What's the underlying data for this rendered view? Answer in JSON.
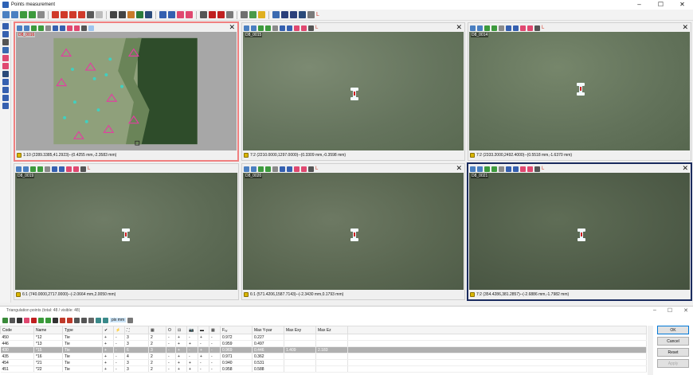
{
  "window": {
    "title": "Points measurement",
    "min": "–",
    "max": "☐",
    "close": "✕"
  },
  "colors": {
    "selected_red": "#f08080",
    "selected_blue": "#1a2b5e",
    "grass": "#5f6f52"
  },
  "panels": [
    {
      "label": "D8_0016",
      "close": "✕",
      "status": "1:10 (2289.3385,41.2923)--(0.4255 mm,-2.3583 mm)"
    },
    {
      "label": "D8_0015",
      "close": "✕",
      "status": "7:2 (2210.0000,1297.0000)--(0.3309 mm,-0.3598 mm)"
    },
    {
      "label": "D8_0014",
      "close": "✕",
      "status": "7:2 (2333.2000,2492.4000)--(0.5518 mm,-1.6370 mm)"
    },
    {
      "label": "D8_0019",
      "close": "✕",
      "status": "6:1 (740.0000,2717.0000)--(-2.0664 mm,2.0050 mm)"
    },
    {
      "label": "D8_0020",
      "close": "✕",
      "status": "6:1 (571.4206,1587.7143)--(-2.3430 mm,0.1793 mm)"
    },
    {
      "label": "D8_0021",
      "close": "✕",
      "status": "7:2 (354.4286,381.2857)--(-2.6886 mm,-1.7982 mm)"
    }
  ],
  "triangulation": {
    "title": "Triangulation points (total: 48 / visible: 48)",
    "window_buttons": [
      "–",
      "☐",
      "✕"
    ],
    "units_label": "pix mm",
    "columns": [
      "Code",
      "Name",
      "Type",
      "✔",
      "⚡",
      "⛶",
      "▦",
      "O",
      "⊟",
      "📷",
      "▬",
      "▦",
      "Fₓᵧ",
      "Max Y-par",
      "Max Exy",
      "Max Ez"
    ],
    "rows": [
      [
        "450",
        "*12",
        "Tie",
        "+",
        "-",
        "3",
        "2",
        "-",
        "+",
        "-",
        "+",
        "-",
        "0.972",
        "0.227",
        "",
        ""
      ],
      [
        "446",
        "*13",
        "Tie",
        "+",
        "-",
        "3",
        "2",
        "-",
        "+",
        "+",
        "-",
        "-",
        "0.959",
        "0.497",
        "",
        ""
      ],
      [
        "430",
        "*15",
        "Tie",
        "+",
        "-",
        "6",
        "3",
        "-",
        "+",
        "-",
        "+",
        "-",
        "0.969",
        "0.446",
        "1.409",
        "2.183"
      ],
      [
        "435",
        "*16",
        "Tie",
        "+",
        "-",
        "4",
        "2",
        "-",
        "+",
        "-",
        "+",
        "-",
        "0.971",
        "0.362",
        "",
        ""
      ],
      [
        "454",
        "*21",
        "Tie",
        "+",
        "-",
        "3",
        "2",
        "-",
        "+",
        "+",
        "-",
        "-",
        "0.940",
        "0.531",
        "",
        ""
      ],
      [
        "451",
        "*22",
        "Tie",
        "+",
        "-",
        "3",
        "2",
        "-",
        "+",
        "+",
        "-",
        "-",
        "0.958",
        "0.588",
        "",
        ""
      ]
    ],
    "buttons": {
      "ok": "OK",
      "cancel": "Cancel",
      "reset": "Reset",
      "apply": "Apply"
    }
  },
  "icons": [
    "zoom-in-icon",
    "zoom-out-icon",
    "fit-icon",
    "arrow-left-icon",
    "arrow-right-icon",
    "undo-icon",
    "layout-icon",
    "point-add-icon",
    "point-remove-icon",
    "save-icon",
    "settings-icon"
  ]
}
